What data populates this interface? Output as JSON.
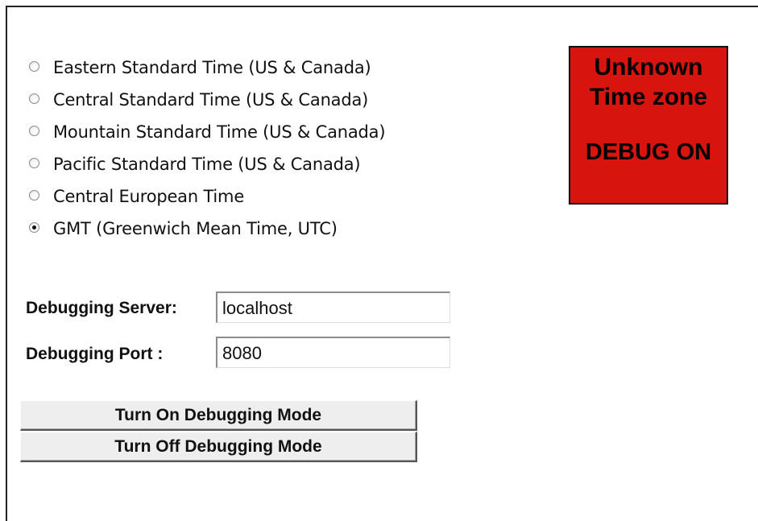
{
  "timezones": {
    "options": [
      {
        "label": "Eastern Standard Time (US & Canada)",
        "checked": false
      },
      {
        "label": "Central Standard Time (US & Canada)",
        "checked": false
      },
      {
        "label": "Mountain Standard Time (US & Canada)",
        "checked": false
      },
      {
        "label": "Pacific Standard Time (US & Canada)",
        "checked": false
      },
      {
        "label": "Central European Time",
        "checked": false
      },
      {
        "label": "GMT (Greenwich Mean Time, UTC)",
        "checked": true
      }
    ]
  },
  "status": {
    "line1": "Unknown",
    "line2": "Time zone",
    "debug": "DEBUG ON",
    "color": "#d8140f"
  },
  "debugging": {
    "server_label": "Debugging Server:",
    "server_value": "localhost",
    "port_label": "Debugging Port :",
    "port_value": "8080"
  },
  "buttons": {
    "turn_on": "Turn On Debugging Mode",
    "turn_off": "Turn Off Debugging Mode"
  }
}
